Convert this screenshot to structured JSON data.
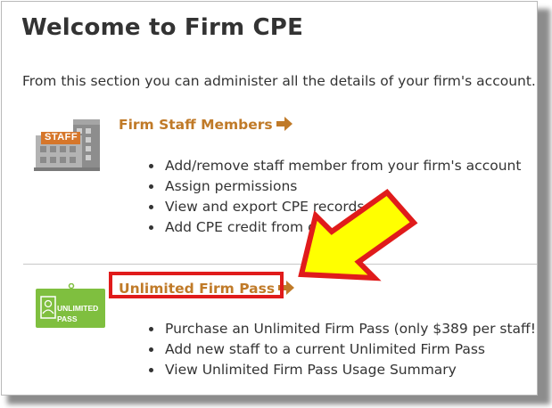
{
  "page": {
    "title": "Welcome to Firm CPE",
    "intro": "From this section you can administer all the details of your firm's account."
  },
  "sections": [
    {
      "link_label": "Firm Staff Members",
      "icon": "staff-building-icon",
      "icon_text": "STAFF",
      "bullets": [
        "Add/remove staff member from your firm's account",
        "Assign permissions",
        "View and export CPE records",
        "Add CPE credit from oth"
      ]
    },
    {
      "link_label": "Unlimited Firm Pass",
      "icon": "unlimited-pass-icon",
      "icon_text_line1": "UNLIMITED",
      "icon_text_line2": "PASS",
      "bullets": [
        "Purchase an Unlimited Firm Pass (only $389 per staff!)",
        "Add new staff to a current Unlimited Firm Pass",
        "View Unlimited Firm Pass Usage Summary"
      ]
    }
  ],
  "colors": {
    "link": "#c07a28",
    "highlight": "#e01b1b",
    "callout_arrow": "#ffff00",
    "pass_card": "#7fbf3f"
  }
}
